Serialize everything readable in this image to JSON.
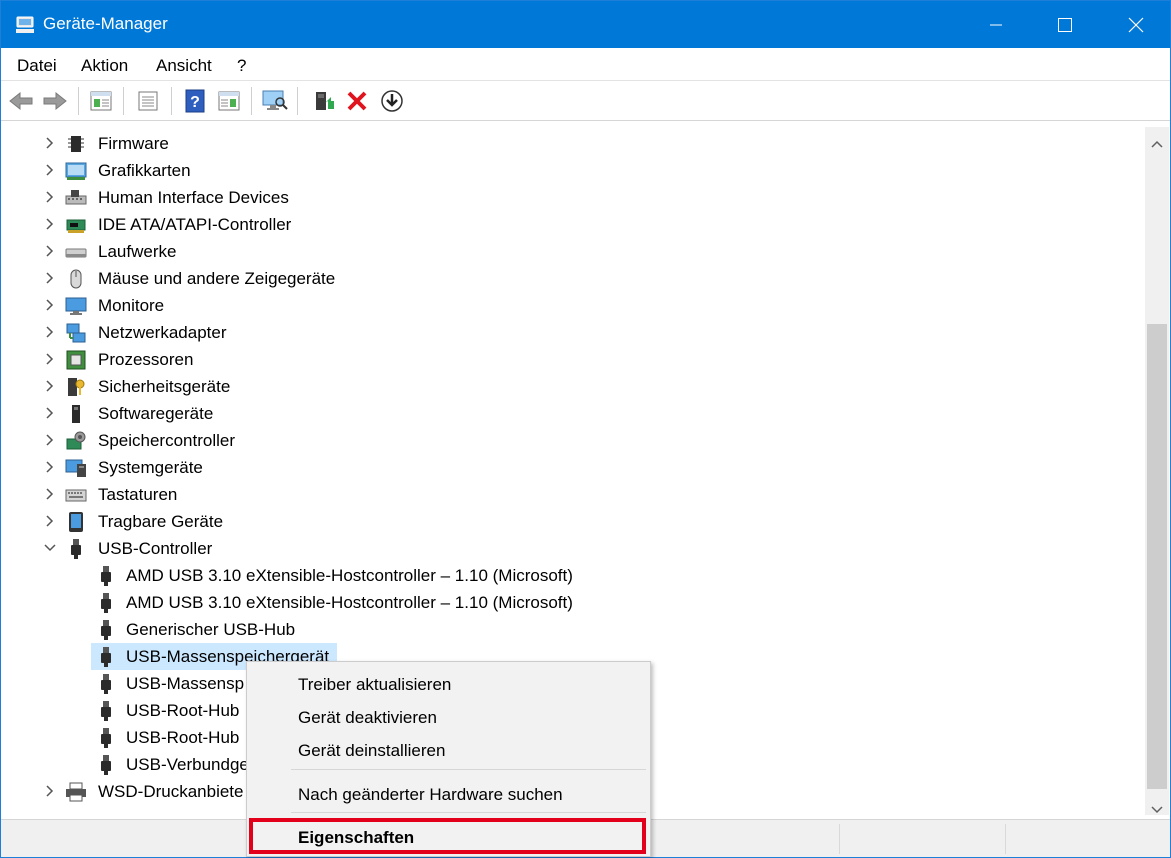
{
  "window": {
    "title": "Geräte-Manager"
  },
  "menu": [
    "Datei",
    "Aktion",
    "Ansicht",
    "?"
  ],
  "toolbar": {
    "icons": [
      "back-icon",
      "forward-icon",
      "console-tree-icon",
      "properties-icon",
      "help-icon",
      "action-pane-icon",
      "scan-hardware-icon",
      "update-driver-icon",
      "uninstall-icon",
      "download-icon"
    ]
  },
  "tree": {
    "categories": [
      {
        "label": "Firmware",
        "icon": "firmware-icon"
      },
      {
        "label": "Grafikkarten",
        "icon": "display-adapter-icon"
      },
      {
        "label": "Human Interface Devices",
        "icon": "hid-icon"
      },
      {
        "label": "IDE ATA/ATAPI-Controller",
        "icon": "ide-controller-icon"
      },
      {
        "label": "Laufwerke",
        "icon": "disk-drive-icon"
      },
      {
        "label": "Mäuse und andere Zeigegeräte",
        "icon": "mouse-icon"
      },
      {
        "label": "Monitore",
        "icon": "monitor-icon"
      },
      {
        "label": "Netzwerkadapter",
        "icon": "network-adapter-icon"
      },
      {
        "label": "Prozessoren",
        "icon": "processor-icon"
      },
      {
        "label": "Sicherheitsgeräte",
        "icon": "security-device-icon"
      },
      {
        "label": "Softwaregeräte",
        "icon": "software-device-icon"
      },
      {
        "label": "Speichercontroller",
        "icon": "storage-controller-icon"
      },
      {
        "label": "Systemgeräte",
        "icon": "system-device-icon"
      },
      {
        "label": "Tastaturen",
        "icon": "keyboard-icon"
      },
      {
        "label": "Tragbare Geräte",
        "icon": "portable-device-icon"
      }
    ],
    "usb_category": "USB-Controller",
    "usb_children": [
      "AMD USB 3.10 eXtensible-Hostcontroller – 1.10 (Microsoft)",
      "AMD USB 3.10 eXtensible-Hostcontroller – 1.10 (Microsoft)",
      "Generischer USB-Hub",
      "USB-Massenspeichergerät",
      "USB-Massensp",
      "USB-Root-Hub",
      "USB-Root-Hub",
      "USB-Verbundge"
    ],
    "selected_child": "USB-Massenspeichergerät",
    "last_category": "WSD-Druckanbiete"
  },
  "context_menu": {
    "update_driver": "Treiber aktualisieren",
    "disable_device": "Gerät deaktivieren",
    "uninstall_device": "Gerät deinstallieren",
    "scan_hardware": "Nach geänderter Hardware suchen",
    "properties": "Eigenschaften"
  },
  "colors": {
    "titlebar": "#0078d7",
    "selection": "#cce8ff",
    "highlight_box": "#e3001b"
  }
}
